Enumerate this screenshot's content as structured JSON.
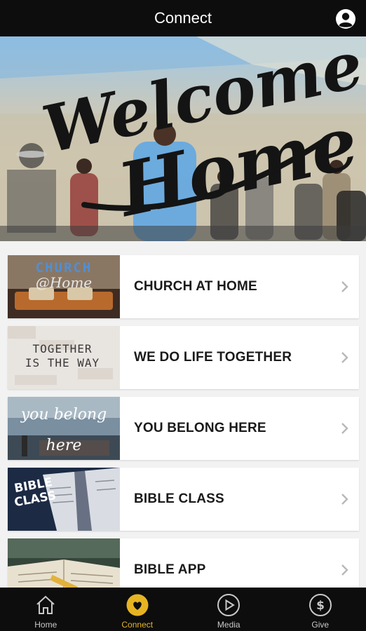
{
  "header": {
    "title": "Connect",
    "profile_icon": "person-circle-icon"
  },
  "hero": {
    "line1": "Welcome",
    "line2": "Home"
  },
  "thumbs": {
    "church_at_home_line1": "CHURCH",
    "church_at_home_line2": "@Home",
    "together_line1": "TOGETHER",
    "together_line2": "IS THE WAY",
    "belong_line1": "you belong",
    "belong_line2": "here",
    "bible_class_line1": "BIBLE",
    "bible_class_line2": "CLASS"
  },
  "items": [
    {
      "label": "CHURCH AT HOME"
    },
    {
      "label": "WE DO LIFE TOGETHER"
    },
    {
      "label": "YOU BELONG HERE"
    },
    {
      "label": "BIBLE CLASS"
    },
    {
      "label": "BIBLE APP"
    }
  ],
  "tabs": [
    {
      "label": "Home",
      "icon": "home-icon",
      "active": false
    },
    {
      "label": "Connect",
      "icon": "heart-icon",
      "active": true
    },
    {
      "label": "Media",
      "icon": "play-icon",
      "active": false
    },
    {
      "label": "Give",
      "icon": "dollar-icon",
      "active": false
    }
  ],
  "colors": {
    "bar_background": "#0d0d0d",
    "active_tab": "#e6b422",
    "inactive_tab": "#c8c8c8"
  }
}
